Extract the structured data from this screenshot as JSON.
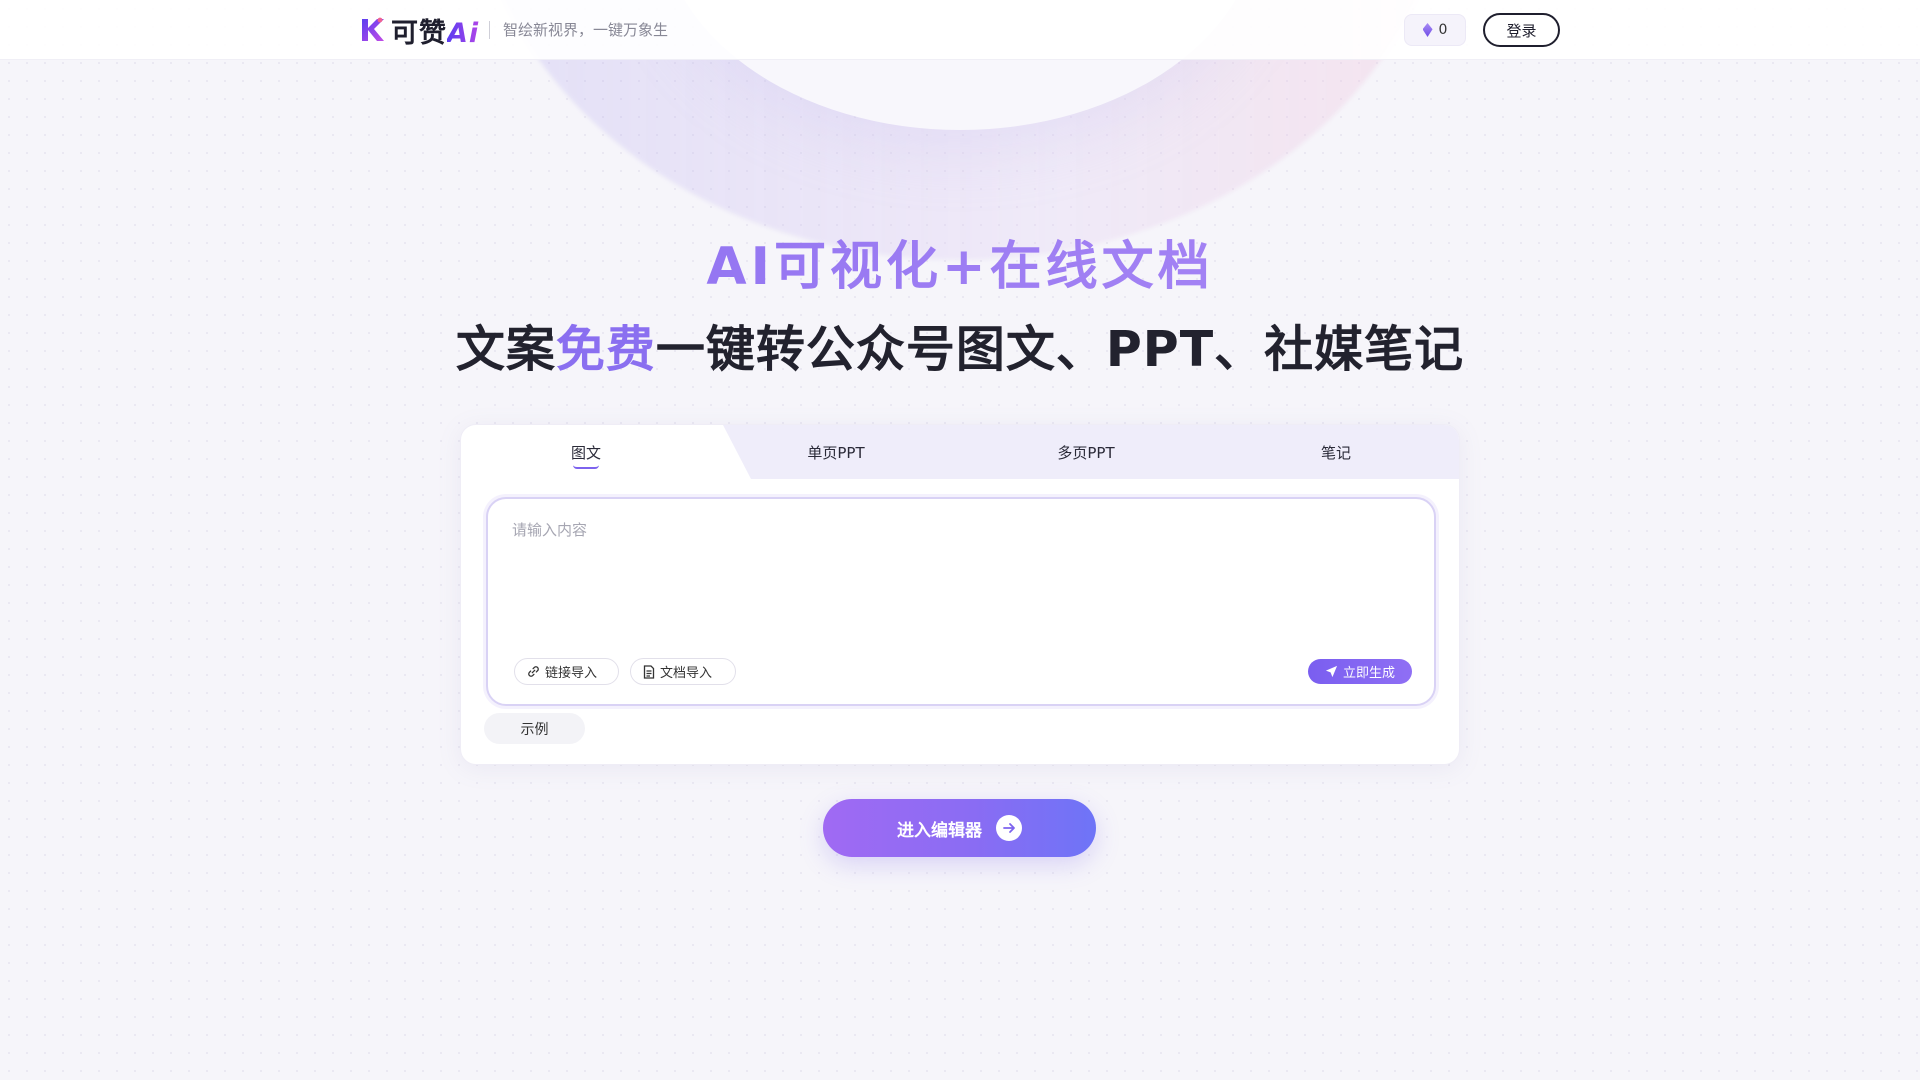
{
  "header": {
    "logo_text": "可赞",
    "logo_ai": "Ai",
    "slogan": "智绘新视界，一键万象生",
    "credits_value": "0",
    "login_label": "登录"
  },
  "hero": {
    "headline": "AI可视化+在线文档",
    "sub_prefix": "文案",
    "sub_highlight": "免费",
    "sub_suffix": "一键转公众号图文、PPT、社媒笔记"
  },
  "tabs": [
    {
      "label": "图文",
      "active": true
    },
    {
      "label": "单页PPT",
      "active": false
    },
    {
      "label": "多页PPT",
      "active": false
    },
    {
      "label": "笔记",
      "active": false
    }
  ],
  "input": {
    "placeholder": "请输入内容",
    "link_import_label": "链接导入",
    "doc_import_label": "文档导入",
    "generate_label": "立即生成"
  },
  "example_label": "示例",
  "editor_button_label": "进入编辑器",
  "colors": {
    "accent": "#7d63ee",
    "accent_light": "#b18ef5",
    "text_dark": "#22222e",
    "tab_bar_bg": "#efedfa"
  },
  "icons": {
    "credits": "diamond-icon",
    "link_import": "link-icon",
    "doc_import": "document-icon",
    "generate": "send-icon",
    "editor": "arrow-right-icon"
  }
}
